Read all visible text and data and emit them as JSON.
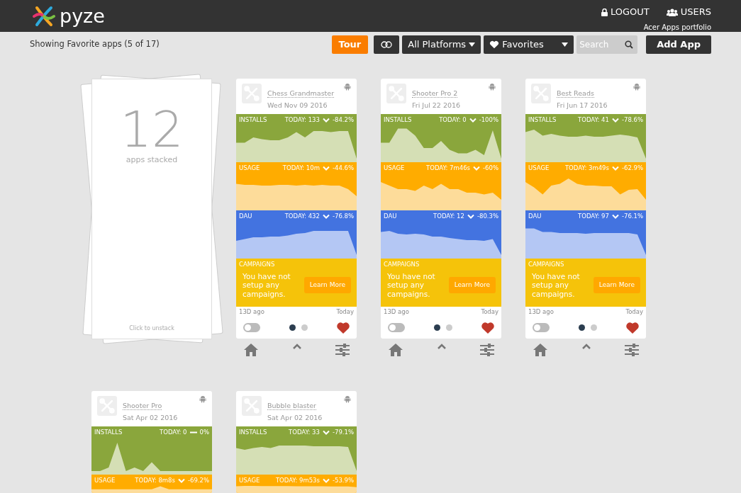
{
  "header": {
    "brand": "pyze",
    "logout": "LOGOUT",
    "users": "USERS",
    "portfolio": "Acer Apps portfolio"
  },
  "toolbar": {
    "summary": "Showing Favorite apps (5 of 17)",
    "tour": "Tour",
    "platforms": "All Platforms",
    "favorites": "Favorites",
    "search": {
      "placeholder": "Search"
    },
    "add": "Add App"
  },
  "stack": {
    "count": "12",
    "label": "apps stacked",
    "hint": "Click to unstack"
  },
  "apps": [
    {
      "name": "Chess Grandmaster",
      "date": "Wed Nov 09 2016",
      "metrics": [
        {
          "kind": "installs",
          "label": "INSTALLS",
          "today": "TODAY: 133",
          "declining": true,
          "change": "-84.2%"
        },
        {
          "kind": "usage",
          "label": "USAGE",
          "today": "TODAY: 10m",
          "declining": true,
          "change": "-44.6%"
        },
        {
          "kind": "dau",
          "label": "DAU",
          "today": "TODAY: 432",
          "declining": true,
          "change": "-76.8%"
        }
      ],
      "campaigns": {
        "label": "CAMPAIGNS",
        "message": "You have not setup any campaigns.",
        "button": "Learn More"
      },
      "from": "13D ago",
      "to": "Today",
      "on": false,
      "pages": [
        {
          "selected": true
        },
        {
          "selected": false
        }
      ],
      "favorite": true
    },
    {
      "name": "Shooter Pro 2",
      "date": "Fri Jul 22 2016",
      "metrics": [
        {
          "kind": "installs",
          "label": "INSTALLS",
          "today": "TODAY: 0",
          "declining": true,
          "change": "-100%"
        },
        {
          "kind": "usage",
          "label": "USAGE",
          "today": "TODAY: 7m46s",
          "declining": true,
          "change": "-60%"
        },
        {
          "kind": "dau",
          "label": "DAU",
          "today": "TODAY: 12",
          "declining": true,
          "change": "-80.3%"
        }
      ],
      "campaigns": {
        "label": "CAMPAIGNS",
        "message": "You have not setup any campaigns.",
        "button": "Learn More"
      },
      "from": "13D ago",
      "to": "Today",
      "on": false,
      "pages": [
        {
          "selected": true
        },
        {
          "selected": false
        }
      ],
      "favorite": true
    },
    {
      "name": "Best Reads",
      "date": "Fri Jun 17 2016",
      "metrics": [
        {
          "kind": "installs",
          "label": "INSTALLS",
          "today": "TODAY: 41",
          "declining": true,
          "change": "-78.6%"
        },
        {
          "kind": "usage",
          "label": "USAGE",
          "today": "TODAY: 3m49s",
          "declining": true,
          "change": "-62.9%"
        },
        {
          "kind": "dau",
          "label": "DAU",
          "today": "TODAY: 97",
          "declining": true,
          "change": "-76.1%"
        }
      ],
      "campaigns": {
        "label": "CAMPAIGNS",
        "message": "You have not setup any campaigns.",
        "button": "Learn More"
      },
      "from": "13D ago",
      "to": "Today",
      "on": false,
      "pages": [
        {
          "selected": true
        },
        {
          "selected": false
        }
      ],
      "favorite": true
    },
    {
      "name": "Shooter Pro",
      "date": "Sat Apr 02 2016",
      "metrics": [
        {
          "kind": "installs",
          "label": "INSTALLS",
          "today": "TODAY: 0",
          "declining": false,
          "change": "0%"
        },
        {
          "kind": "usage",
          "label": "USAGE",
          "today": "TODAY: 8m8s",
          "declining": true,
          "change": "-69.2%"
        }
      ]
    },
    {
      "name": "Bubble blaster",
      "date": "Sat Apr 02 2016",
      "metrics": [
        {
          "kind": "installs",
          "label": "INSTALLS",
          "today": "TODAY: 33",
          "declining": true,
          "change": "-79.1%"
        },
        {
          "kind": "usage",
          "label": "USAGE",
          "today": "TODAY: 9m53s",
          "declining": true,
          "change": "-53.9%"
        }
      ]
    }
  ]
}
